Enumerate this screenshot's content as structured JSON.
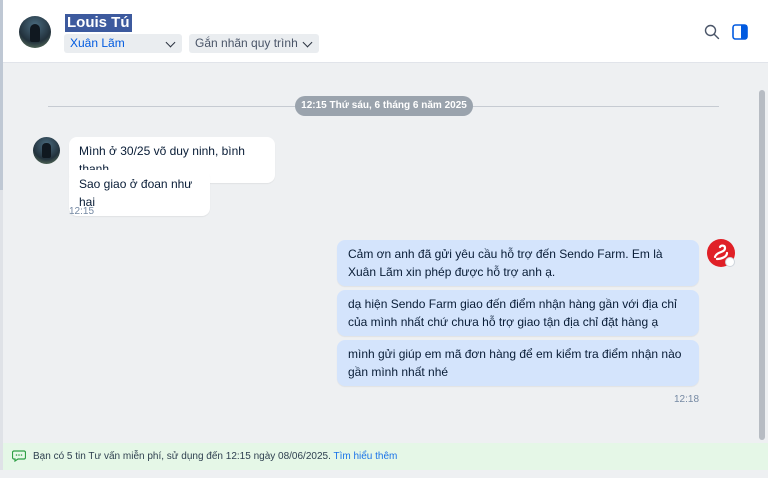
{
  "header": {
    "contact_name": "Louis Tú",
    "assignee": "Xuân Lãm",
    "tag_placeholder": "Gắn nhãn quy trình",
    "icons": [
      "search-icon",
      "side-panel-icon"
    ]
  },
  "conversation": {
    "date_divider": "12:15 Thứ sáu, 6 tháng 6 năm 2025",
    "incoming": {
      "messages": [
        "Mình ở 30/25 võ duy ninh, bình thạnh,",
        "Sao giao ở đoan như hai"
      ],
      "time": "12:15"
    },
    "outgoing": {
      "messages": [
        "Cảm ơn anh đã gửi yêu cầu hỗ trợ đến Sendo Farm. Em là Xuân Lãm xin phép được hỗ trợ anh ạ.",
        "dạ hiện Sendo Farm giao đến điểm nhận hàng gần với địa chỉ của mình nhất chứ chưa hỗ trợ giao tận địa chỉ đặt hàng ạ",
        "mình gửi giúp em mã đơn hàng để em kiểm tra điểm nhận nào gần mình nhất nhé"
      ],
      "time": "12:18"
    }
  },
  "footer": {
    "notice": "Bạn có 5 tin Tư vấn miễn phí, sử dụng đến 12:15 ngày 08/06/2025.",
    "link": "Tìm hiểu thêm"
  },
  "colors": {
    "accent": "#005ae0",
    "outgoing_bubble": "#d4e4fc",
    "footer_bg": "#e5f7e7",
    "brand_red": "#e02027"
  }
}
